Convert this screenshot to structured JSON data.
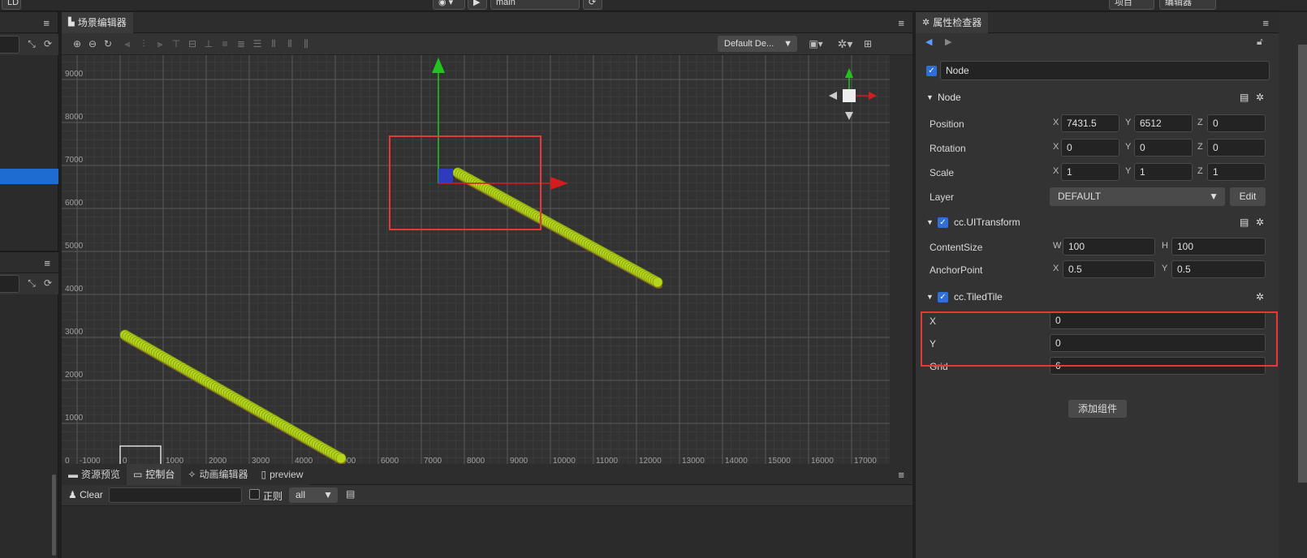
{
  "topbar": {
    "left_label": "LD",
    "scene_select": "main",
    "right_info": "...",
    "right_btn1": "项目",
    "right_btn2": "编辑器"
  },
  "left_panels": {
    "tab1_menu": "≡",
    "tab2_menu": "≡"
  },
  "scene_editor": {
    "title": "场景编辑器",
    "camera_select": "Default De...",
    "y_ticks": [
      "9000",
      "8000",
      "7000",
      "6000",
      "5000",
      "4000",
      "3000",
      "2000",
      "1000",
      "0"
    ],
    "x_ticks": [
      "-1000",
      "0",
      "1000",
      "2000",
      "3000",
      "4000",
      "5000",
      "6000",
      "7000",
      "8000",
      "9000",
      "10000",
      "11000",
      "12000",
      "13000",
      "14000",
      "15000",
      "16000",
      "17000"
    ]
  },
  "bottom_panel": {
    "tabs": [
      {
        "label": "资源预览",
        "active": false
      },
      {
        "label": "控制台",
        "active": true
      },
      {
        "label": "动画编辑器",
        "active": false
      },
      {
        "label": "preview",
        "active": false
      }
    ],
    "clear_label": "Clear",
    "regex_label": "正则",
    "filter_value": "all"
  },
  "inspector": {
    "title": "属性检查器",
    "node_name": "Node",
    "node_section": "Node",
    "position": {
      "label": "Position",
      "x": "7431.5",
      "y": "6512",
      "z": "0"
    },
    "rotation": {
      "label": "Rotation",
      "x": "0",
      "y": "0",
      "z": "0"
    },
    "scale": {
      "label": "Scale",
      "x": "1",
      "y": "1",
      "z": "1"
    },
    "layer": {
      "label": "Layer",
      "value": "DEFAULT",
      "edit_label": "Edit"
    },
    "ui_transform": {
      "title": "cc.UITransform",
      "content_size_label": "ContentSize",
      "w": "100",
      "h": "100",
      "anchor_label": "AnchorPoint",
      "ax": "0.5",
      "ay": "0.5"
    },
    "tiled_tile": {
      "title": "cc.TiledTile",
      "x_label": "X",
      "x_value": "0",
      "y_label": "Y",
      "y_value": "0",
      "grid_label": "Grid",
      "grid_value": "6"
    },
    "add_component": "添加组件"
  },
  "axis_labels": {
    "x": "X",
    "y": "Y",
    "z": "Z",
    "w": "W",
    "h": "H"
  },
  "colors": {
    "highlight_red": "#e53935",
    "gizmo_green": "#22c31f",
    "gizmo_red": "#d11d1d",
    "tile_green": "#b5d61a",
    "selection_blue": "#1e6bd1"
  }
}
